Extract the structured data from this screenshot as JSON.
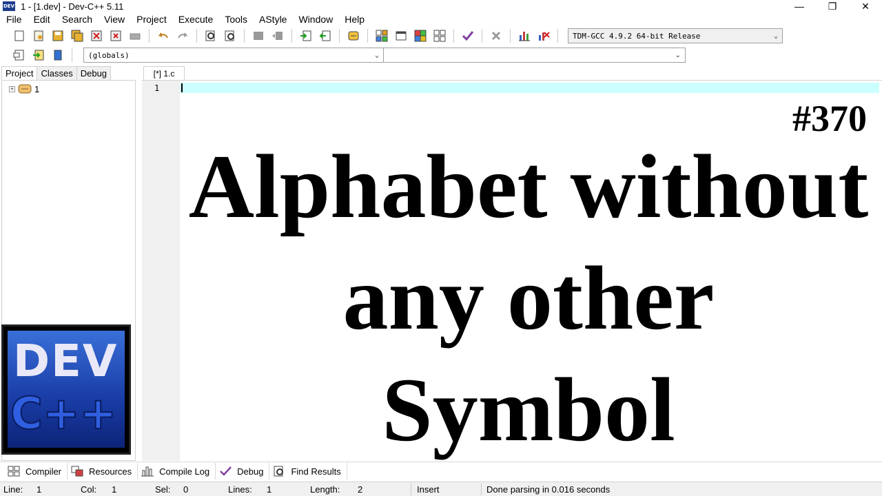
{
  "window": {
    "app_icon_text": "DEV",
    "title": "1 - [1.dev] - Dev-C++ 5.11",
    "minimize": "—",
    "restore": "❐",
    "close": "✕"
  },
  "menu": [
    "File",
    "Edit",
    "Search",
    "View",
    "Project",
    "Execute",
    "Tools",
    "AStyle",
    "Window",
    "Help"
  ],
  "toolbar": {
    "compiler": "TDM-GCC 4.9.2 64-bit Release",
    "scope": "(globals)",
    "function": ""
  },
  "left_panel": {
    "tabs": [
      "Project",
      "Classes",
      "Debug"
    ],
    "active_tab": "Project",
    "tree_root": "1",
    "expander": "+"
  },
  "logo": {
    "top_text": "DEV",
    "bottom_text": "C++"
  },
  "editor": {
    "tab_label": "[*] 1.c",
    "line_number": "1"
  },
  "overlay": {
    "episode": "#370",
    "line1": "Alphabet without",
    "line2": "any other",
    "line3": "Symbol"
  },
  "bottom_tabs": [
    "Compiler",
    "Resources",
    "Compile Log",
    "Debug",
    "Find Results"
  ],
  "status": {
    "line_label": "Line:",
    "line_value": "1",
    "col_label": "Col:",
    "col_value": "1",
    "sel_label": "Sel:",
    "sel_value": "0",
    "lines_label": "Lines:",
    "lines_value": "1",
    "length_label": "Length:",
    "length_value": "2",
    "mode": "Insert",
    "message": "Done parsing in 0.016 seconds"
  }
}
